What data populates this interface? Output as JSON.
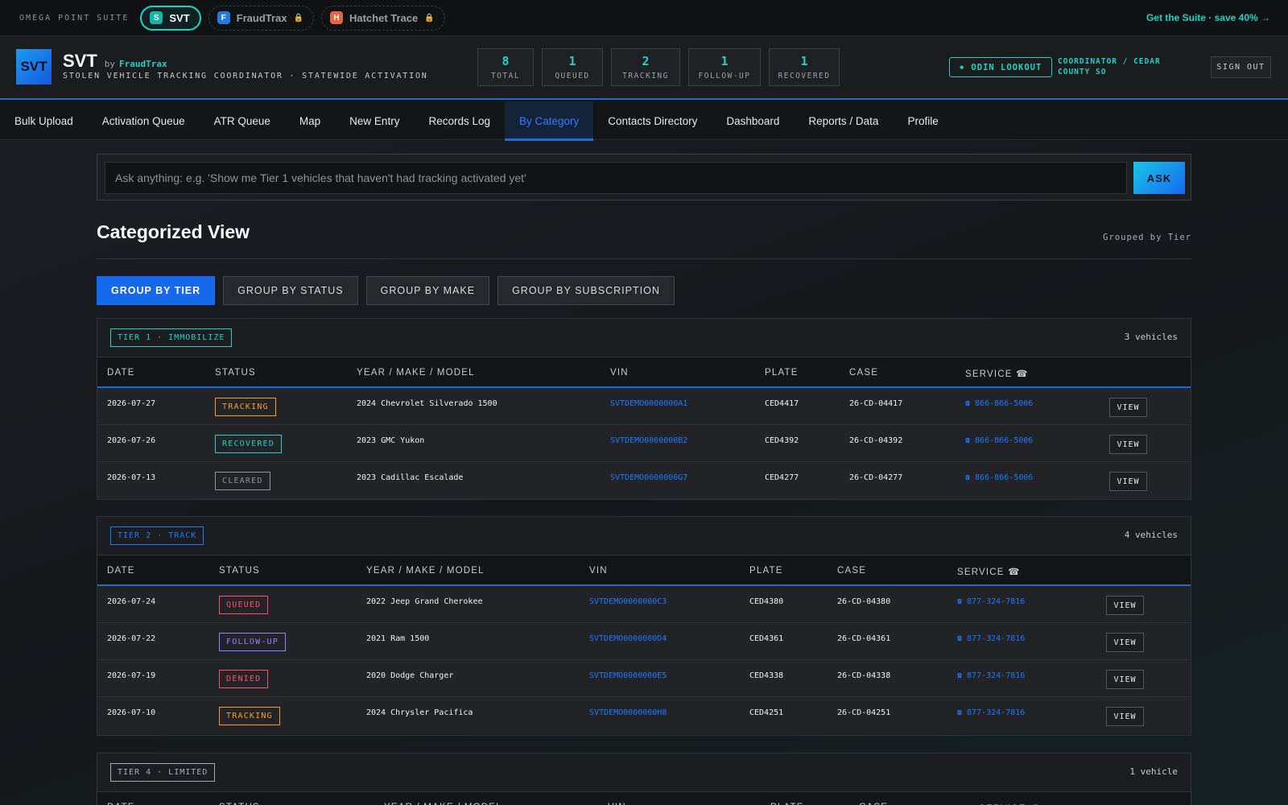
{
  "suite": {
    "name": "OMEGA POINT SUITE",
    "apps": [
      {
        "label": "SVT",
        "badge": "S",
        "badge_color": "#15b8a6",
        "active": true,
        "locked": false
      },
      {
        "label": "FraudTrax",
        "badge": "F",
        "badge_color": "#1f7be0",
        "active": false,
        "locked": true
      },
      {
        "label": "Hatchet Trace",
        "badge": "H",
        "badge_color": "#e5663a",
        "active": false,
        "locked": true
      }
    ],
    "promo": "Get the Suite · save 40% →"
  },
  "header": {
    "logo": "SVT",
    "title": "SVT",
    "by": "by",
    "by_brand": "FraudTrax",
    "tagline": "STOLEN VEHICLE TRACKING COORDINATOR · STATEWIDE ACTIVATION",
    "stats": [
      {
        "value": "8",
        "label": "TOTAL"
      },
      {
        "value": "1",
        "label": "QUEUED"
      },
      {
        "value": "2",
        "label": "TRACKING"
      },
      {
        "value": "1",
        "label": "FOLLOW-UP"
      },
      {
        "value": "1",
        "label": "RECOVERED"
      }
    ],
    "odin_label": "ODIN LOOKOUT",
    "coordinator": "COORDINATOR / CEDAR COUNTY SO",
    "signout": "SIGN OUT"
  },
  "nav": [
    {
      "label": "Bulk Upload",
      "active": false
    },
    {
      "label": "Activation Queue",
      "active": false
    },
    {
      "label": "ATR Queue",
      "active": false
    },
    {
      "label": "Map",
      "active": false
    },
    {
      "label": "New Entry",
      "active": false
    },
    {
      "label": "Records Log",
      "active": false
    },
    {
      "label": "By Category",
      "active": true
    },
    {
      "label": "Contacts Directory",
      "active": false
    },
    {
      "label": "Dashboard",
      "active": false
    },
    {
      "label": "Reports / Data",
      "active": false
    },
    {
      "label": "Profile",
      "active": false
    }
  ],
  "ask": {
    "placeholder": "Ask anything: e.g. 'Show me Tier 1 vehicles that haven't had tracking activated yet'",
    "button": "ASK"
  },
  "page": {
    "title": "Categorized View",
    "grouped_label": "Grouped by Tier",
    "group_buttons": [
      {
        "label": "GROUP BY TIER",
        "active": true
      },
      {
        "label": "GROUP BY STATUS",
        "active": false
      },
      {
        "label": "GROUP BY MAKE",
        "active": false
      },
      {
        "label": "GROUP BY SUBSCRIPTION",
        "active": false
      }
    ]
  },
  "columns": [
    "DATE",
    "STATUS",
    "YEAR / MAKE / MODEL",
    "VIN",
    "PLATE",
    "CASE",
    "SERVICE ☎"
  ],
  "status_colors": {
    "TRACKING": "#f0a020",
    "RECOVERED": "#19d3c5",
    "CLEARED": "#8d9399",
    "QUEUED": "#ff4d6d",
    "FOLLOW-UP": "#9b7bff",
    "DENIED": "#ff4d6d"
  },
  "tiers": [
    {
      "tag": "TIER 1 · IMMOBILIZE",
      "tag_color": "#19d3c5",
      "count": "3 vehicles",
      "rows": [
        {
          "date": "2026-07-27",
          "status": "TRACKING",
          "vehicle": "2024 Chevrolet Silverado 1500",
          "vin": "SVTDEMO0000000A1",
          "plate": "CED4417",
          "case": "26-CD-04417",
          "service": "866-866-5006",
          "action": "VIEW"
        },
        {
          "date": "2026-07-26",
          "status": "RECOVERED",
          "vehicle": "2023 GMC Yukon",
          "vin": "SVTDEMO0000000B2",
          "plate": "CED4392",
          "case": "26-CD-04392",
          "service": "866-866-5006",
          "action": "VIEW"
        },
        {
          "date": "2026-07-13",
          "status": "CLEARED",
          "vehicle": "2023 Cadillac Escalade",
          "vin": "SVTDEMO0000000G7",
          "plate": "CED4277",
          "case": "26-CD-04277",
          "service": "866-866-5006",
          "action": "VIEW"
        }
      ]
    },
    {
      "tag": "TIER 2 · TRACK",
      "tag_color": "#1f77ff",
      "count": "4 vehicles",
      "rows": [
        {
          "date": "2026-07-24",
          "status": "QUEUED",
          "vehicle": "2022 Jeep Grand Cherokee",
          "vin": "SVTDEMO0000000C3",
          "plate": "CED4380",
          "case": "26-CD-04380",
          "service": "877-324-7816",
          "action": "VIEW"
        },
        {
          "date": "2026-07-22",
          "status": "FOLLOW-UP",
          "vehicle": "2021 Ram 1500",
          "vin": "SVTDEMO0000000D4",
          "plate": "CED4361",
          "case": "26-CD-04361",
          "service": "877-324-7816",
          "action": "VIEW"
        },
        {
          "date": "2026-07-19",
          "status": "DENIED",
          "vehicle": "2020 Dodge Charger",
          "vin": "SVTDEMO0000000E5",
          "plate": "CED4338",
          "case": "26-CD-04338",
          "service": "877-324-7816",
          "action": "VIEW"
        },
        {
          "date": "2026-07-10",
          "status": "TRACKING",
          "vehicle": "2024 Chrysler Pacifica",
          "vin": "SVTDEMO0000000H8",
          "plate": "CED4251",
          "case": "26-CD-04251",
          "service": "877-324-7816",
          "action": "VIEW"
        }
      ]
    },
    {
      "tag": "TIER 4 · LIMITED",
      "tag_color": "#a6acb2",
      "count": "1 vehicle",
      "rows": []
    }
  ]
}
